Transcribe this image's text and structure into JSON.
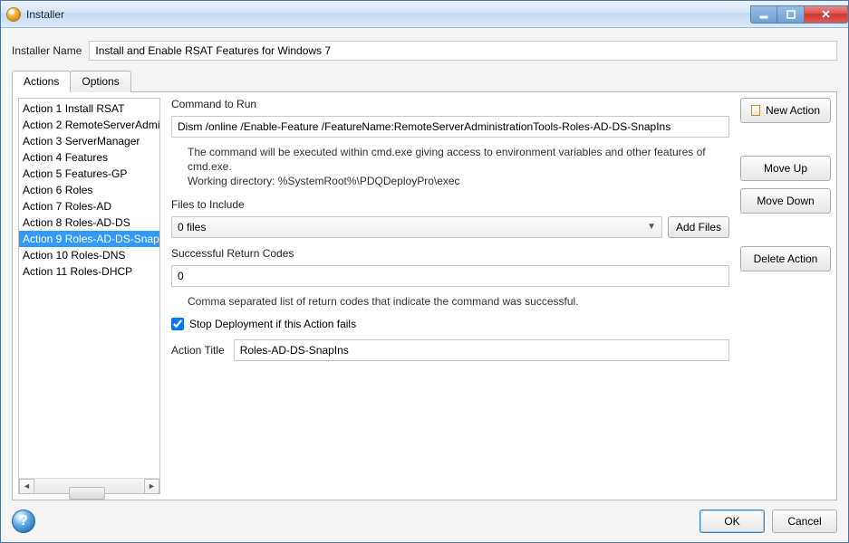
{
  "window": {
    "title": "Installer",
    "buttons": {
      "minimize": "–",
      "maximize": "▢",
      "close": "✕"
    }
  },
  "installer_name": {
    "label": "Installer Name",
    "value": "Install and Enable RSAT Features for Windows 7"
  },
  "tabs": [
    {
      "id": "actions",
      "label": "Actions",
      "active": true
    },
    {
      "id": "options",
      "label": "Options",
      "active": false
    }
  ],
  "actions": {
    "items": [
      {
        "prefix": "Action 1",
        "name": "Install RSAT"
      },
      {
        "prefix": "Action 2",
        "name": "RemoteServerAdministrationTools"
      },
      {
        "prefix": "Action 3",
        "name": "ServerManager"
      },
      {
        "prefix": "Action 4",
        "name": "Features"
      },
      {
        "prefix": "Action 5",
        "name": "Features-GP"
      },
      {
        "prefix": "Action 6",
        "name": "Roles"
      },
      {
        "prefix": "Action 7",
        "name": "Roles-AD"
      },
      {
        "prefix": "Action 8",
        "name": "Roles-AD-DS"
      },
      {
        "prefix": "Action 9",
        "name": "Roles-AD-DS-SnapIns"
      },
      {
        "prefix": "Action 10",
        "name": "Roles-DNS"
      },
      {
        "prefix": "Action 11",
        "name": "Roles-DHCP"
      }
    ],
    "selected_index": 8
  },
  "form": {
    "command_label": "Command to Run",
    "command_value": "Dism /online /Enable-Feature /FeatureName:RemoteServerAdministrationTools-Roles-AD-DS-SnapIns",
    "command_help1": "The command will be executed within cmd.exe giving access to environment variables and other features of cmd.exe.",
    "command_help2": "Working directory: %SystemRoot%\\PDQDeployPro\\exec",
    "files_label": "Files to Include",
    "files_selected": "0 files",
    "add_files": "Add Files",
    "return_codes_label": "Successful Return Codes",
    "return_codes_value": "0",
    "return_codes_help": "Comma separated list of return codes that indicate the command was successful.",
    "stop_deploy_checked": true,
    "stop_deploy_label": "Stop Deployment if this Action fails",
    "action_title_label": "Action Title",
    "action_title_value": "Roles-AD-DS-SnapIns"
  },
  "side": {
    "new_action": "New Action",
    "move_up": "Move Up",
    "move_down": "Move Down",
    "delete_action": "Delete Action"
  },
  "footer": {
    "help": "?",
    "ok": "OK",
    "cancel": "Cancel"
  }
}
